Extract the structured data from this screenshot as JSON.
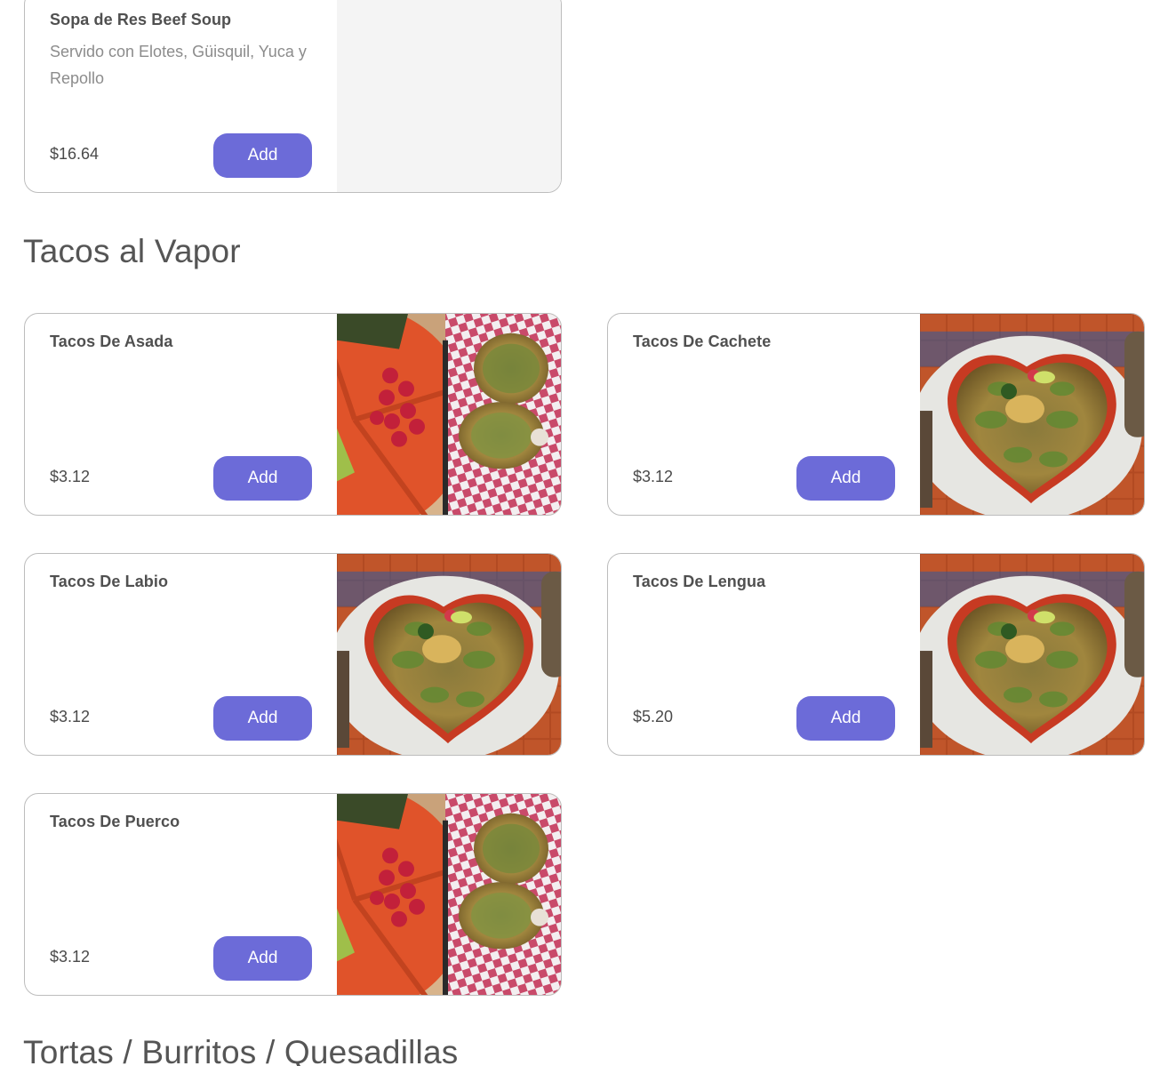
{
  "sections": [
    {
      "items": [
        {
          "name": "Sopa de Res Beef Soup",
          "description": "Servido con Elotes, Güisquil, Yuca y Repollo",
          "price": "$16.64",
          "add_label": "Add",
          "photo": "none"
        }
      ]
    },
    {
      "title": "Tacos al Vapor",
      "items": [
        {
          "name": "Tacos De Asada",
          "price": "$3.12",
          "add_label": "Add",
          "photo": "tacos-tray-photo"
        },
        {
          "name": "Tacos De Cachete",
          "price": "$3.12",
          "add_label": "Add",
          "photo": "tacos-platter-photo"
        },
        {
          "name": "Tacos De Labio",
          "price": "$3.12",
          "add_label": "Add",
          "photo": "tacos-platter-photo"
        },
        {
          "name": "Tacos De Lengua",
          "price": "$5.20",
          "add_label": "Add",
          "photo": "tacos-platter-photo"
        },
        {
          "name": "Tacos De Puerco",
          "price": "$3.12",
          "add_label": "Add",
          "photo": "tacos-tray-photo"
        }
      ]
    },
    {
      "title": "Tortas / Burritos / Quesadillas"
    }
  ],
  "colors": {
    "accent": "#6c6bd8",
    "text": "#4a4a4a",
    "muted": "#8c8c8c",
    "border": "#bdbdbd"
  }
}
